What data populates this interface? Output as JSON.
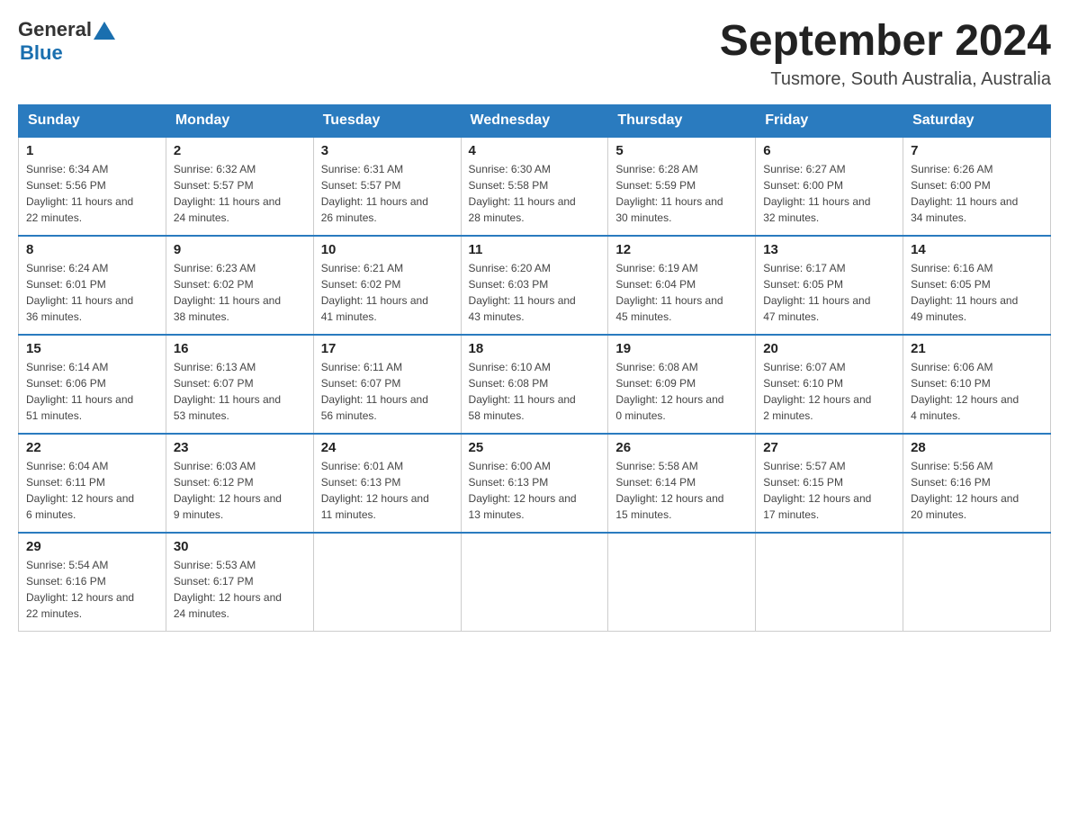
{
  "header": {
    "logo_general": "General",
    "logo_blue": "Blue",
    "month_title": "September 2024",
    "location": "Tusmore, South Australia, Australia"
  },
  "weekdays": [
    "Sunday",
    "Monday",
    "Tuesday",
    "Wednesday",
    "Thursday",
    "Friday",
    "Saturday"
  ],
  "weeks": [
    [
      {
        "day": "1",
        "sunrise": "6:34 AM",
        "sunset": "5:56 PM",
        "daylight": "11 hours and 22 minutes."
      },
      {
        "day": "2",
        "sunrise": "6:32 AM",
        "sunset": "5:57 PM",
        "daylight": "11 hours and 24 minutes."
      },
      {
        "day": "3",
        "sunrise": "6:31 AM",
        "sunset": "5:57 PM",
        "daylight": "11 hours and 26 minutes."
      },
      {
        "day": "4",
        "sunrise": "6:30 AM",
        "sunset": "5:58 PM",
        "daylight": "11 hours and 28 minutes."
      },
      {
        "day": "5",
        "sunrise": "6:28 AM",
        "sunset": "5:59 PM",
        "daylight": "11 hours and 30 minutes."
      },
      {
        "day": "6",
        "sunrise": "6:27 AM",
        "sunset": "6:00 PM",
        "daylight": "11 hours and 32 minutes."
      },
      {
        "day": "7",
        "sunrise": "6:26 AM",
        "sunset": "6:00 PM",
        "daylight": "11 hours and 34 minutes."
      }
    ],
    [
      {
        "day": "8",
        "sunrise": "6:24 AM",
        "sunset": "6:01 PM",
        "daylight": "11 hours and 36 minutes."
      },
      {
        "day": "9",
        "sunrise": "6:23 AM",
        "sunset": "6:02 PM",
        "daylight": "11 hours and 38 minutes."
      },
      {
        "day": "10",
        "sunrise": "6:21 AM",
        "sunset": "6:02 PM",
        "daylight": "11 hours and 41 minutes."
      },
      {
        "day": "11",
        "sunrise": "6:20 AM",
        "sunset": "6:03 PM",
        "daylight": "11 hours and 43 minutes."
      },
      {
        "day": "12",
        "sunrise": "6:19 AM",
        "sunset": "6:04 PM",
        "daylight": "11 hours and 45 minutes."
      },
      {
        "day": "13",
        "sunrise": "6:17 AM",
        "sunset": "6:05 PM",
        "daylight": "11 hours and 47 minutes."
      },
      {
        "day": "14",
        "sunrise": "6:16 AM",
        "sunset": "6:05 PM",
        "daylight": "11 hours and 49 minutes."
      }
    ],
    [
      {
        "day": "15",
        "sunrise": "6:14 AM",
        "sunset": "6:06 PM",
        "daylight": "11 hours and 51 minutes."
      },
      {
        "day": "16",
        "sunrise": "6:13 AM",
        "sunset": "6:07 PM",
        "daylight": "11 hours and 53 minutes."
      },
      {
        "day": "17",
        "sunrise": "6:11 AM",
        "sunset": "6:07 PM",
        "daylight": "11 hours and 56 minutes."
      },
      {
        "day": "18",
        "sunrise": "6:10 AM",
        "sunset": "6:08 PM",
        "daylight": "11 hours and 58 minutes."
      },
      {
        "day": "19",
        "sunrise": "6:08 AM",
        "sunset": "6:09 PM",
        "daylight": "12 hours and 0 minutes."
      },
      {
        "day": "20",
        "sunrise": "6:07 AM",
        "sunset": "6:10 PM",
        "daylight": "12 hours and 2 minutes."
      },
      {
        "day": "21",
        "sunrise": "6:06 AM",
        "sunset": "6:10 PM",
        "daylight": "12 hours and 4 minutes."
      }
    ],
    [
      {
        "day": "22",
        "sunrise": "6:04 AM",
        "sunset": "6:11 PM",
        "daylight": "12 hours and 6 minutes."
      },
      {
        "day": "23",
        "sunrise": "6:03 AM",
        "sunset": "6:12 PM",
        "daylight": "12 hours and 9 minutes."
      },
      {
        "day": "24",
        "sunrise": "6:01 AM",
        "sunset": "6:13 PM",
        "daylight": "12 hours and 11 minutes."
      },
      {
        "day": "25",
        "sunrise": "6:00 AM",
        "sunset": "6:13 PM",
        "daylight": "12 hours and 13 minutes."
      },
      {
        "day": "26",
        "sunrise": "5:58 AM",
        "sunset": "6:14 PM",
        "daylight": "12 hours and 15 minutes."
      },
      {
        "day": "27",
        "sunrise": "5:57 AM",
        "sunset": "6:15 PM",
        "daylight": "12 hours and 17 minutes."
      },
      {
        "day": "28",
        "sunrise": "5:56 AM",
        "sunset": "6:16 PM",
        "daylight": "12 hours and 20 minutes."
      }
    ],
    [
      {
        "day": "29",
        "sunrise": "5:54 AM",
        "sunset": "6:16 PM",
        "daylight": "12 hours and 22 minutes."
      },
      {
        "day": "30",
        "sunrise": "5:53 AM",
        "sunset": "6:17 PM",
        "daylight": "12 hours and 24 minutes."
      },
      null,
      null,
      null,
      null,
      null
    ]
  ],
  "labels": {
    "sunrise": "Sunrise:",
    "sunset": "Sunset:",
    "daylight": "Daylight:"
  }
}
